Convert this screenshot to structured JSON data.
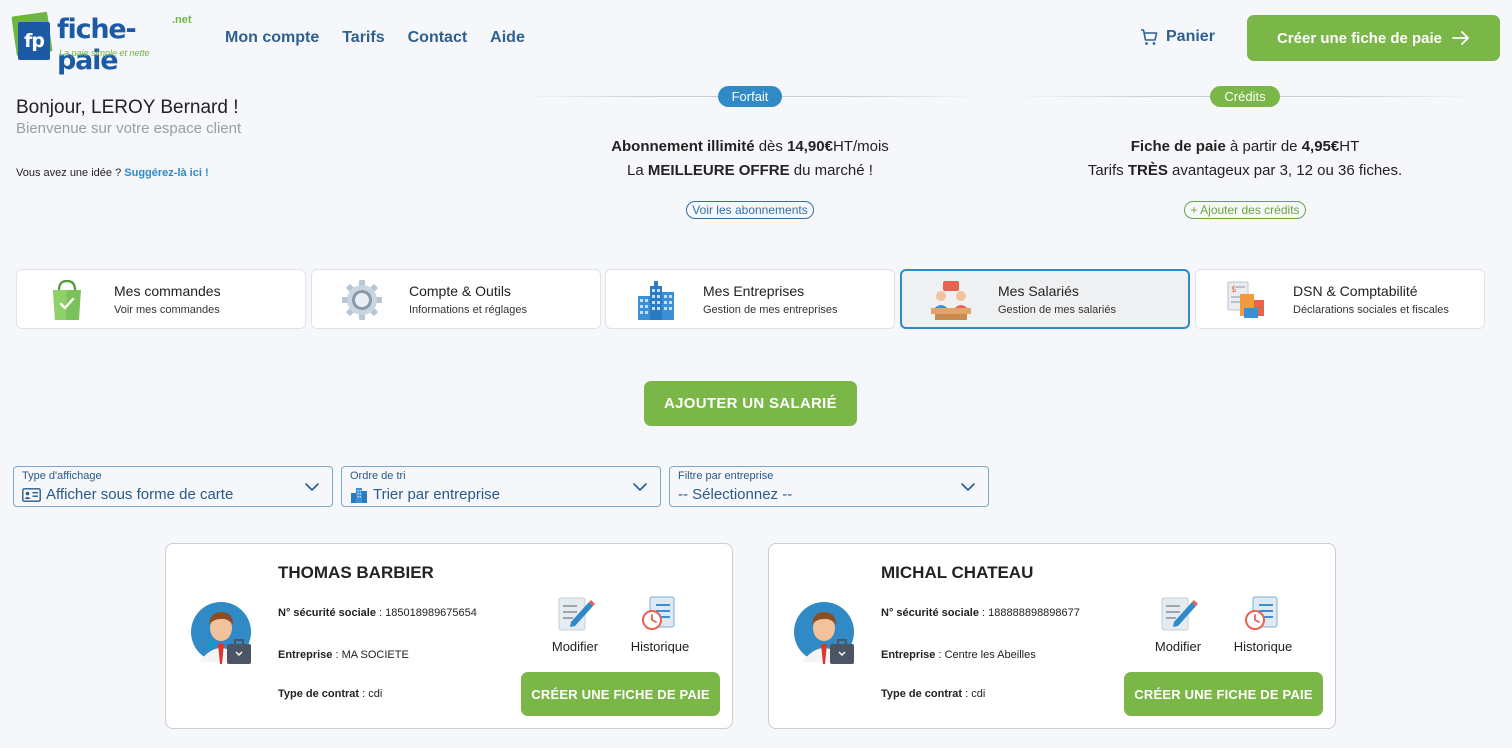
{
  "header": {
    "logo_badge": "fp",
    "logo_name": "fiche-paie",
    "logo_net": ".net",
    "logo_tagline": "La paie simple et nette",
    "nav": [
      "Mon compte",
      "Tarifs",
      "Contact",
      "Aide"
    ],
    "cart_label": "Panier",
    "cta_label": "Créer une fiche de paie"
  },
  "greeting": {
    "title": "Bonjour, LEROY Bernard !",
    "subtitle": "Bienvenue sur votre espace client",
    "idea_prefix": "Vous avez une idée ?",
    "idea_link": "Suggérez-là ici !"
  },
  "offers": [
    {
      "pill": "Forfait",
      "pill_color": "#2f8ac6",
      "line1_bold": "Abonnement illimité",
      "line1_mid": " dès ",
      "line1_price": "14,90€",
      "line1_end": "HT/mois",
      "line2_start": "La ",
      "line2_bold": "MEILLEURE OFFRE",
      "line2_end": " du marché !",
      "link": "Voir les abonnements"
    },
    {
      "pill": "Crédits",
      "pill_color": "#7ab648",
      "line1_bold": "Fiche de paie",
      "line1_mid": " à partir de ",
      "line1_price": "4,95€",
      "line1_end": "HT",
      "line2_start": "Tarifs ",
      "line2_bold": "TRÈS",
      "line2_end": " avantageux par 3, 12 ou 36 fiches.",
      "link": "+ Ajouter des crédits"
    }
  ],
  "tiles": [
    {
      "title": "Mes commandes",
      "subtitle": "Voir mes commandes",
      "icon": "shopping-bag-icon"
    },
    {
      "title": "Compte & Outils",
      "subtitle": "Informations et réglages",
      "icon": "gear-icon"
    },
    {
      "title": "Mes Entreprises",
      "subtitle": "Gestion de mes entreprises",
      "icon": "buildings-icon"
    },
    {
      "title": "Mes Salariés",
      "subtitle": "Gestion de mes salariés",
      "icon": "employees-icon",
      "active": true
    },
    {
      "title": "DSN & Comptabilité",
      "subtitle": "Déclarations sociales et fiscales",
      "icon": "accounting-icon"
    }
  ],
  "add_employee_label": "AJOUTER UN SALARIÉ",
  "filters": [
    {
      "label": "Type d'affichage",
      "value": "Afficher sous forme de carte",
      "icon": "id-card-icon"
    },
    {
      "label": "Ordre de tri",
      "value": "Trier par entreprise",
      "icon": "building-icon"
    },
    {
      "label": "Filtre par entreprise",
      "value": "-- Sélectionnez --",
      "icon": ""
    }
  ],
  "employees": [
    {
      "name": "THOMAS BARBIER",
      "ssn_label": "N° sécurité sociale",
      "ssn": "185018989675654",
      "company_label": "Entreprise",
      "company": "MA SOCIETE",
      "contract_label": "Type de contrat",
      "contract": "cdi",
      "edit_label": "Modifier",
      "history_label": "Historique",
      "create_label": "CRÉER UNE FICHE DE PAIE"
    },
    {
      "name": "MICHAL CHATEAU",
      "ssn_label": "N° sécurité sociale",
      "ssn": "188888898898677",
      "company_label": "Entreprise",
      "company": "Centre les Abeilles",
      "contract_label": "Type de contrat",
      "contract": "cdi",
      "edit_label": "Modifier",
      "history_label": "Historique",
      "create_label": "CRÉER UNE FICHE DE PAIE"
    }
  ]
}
